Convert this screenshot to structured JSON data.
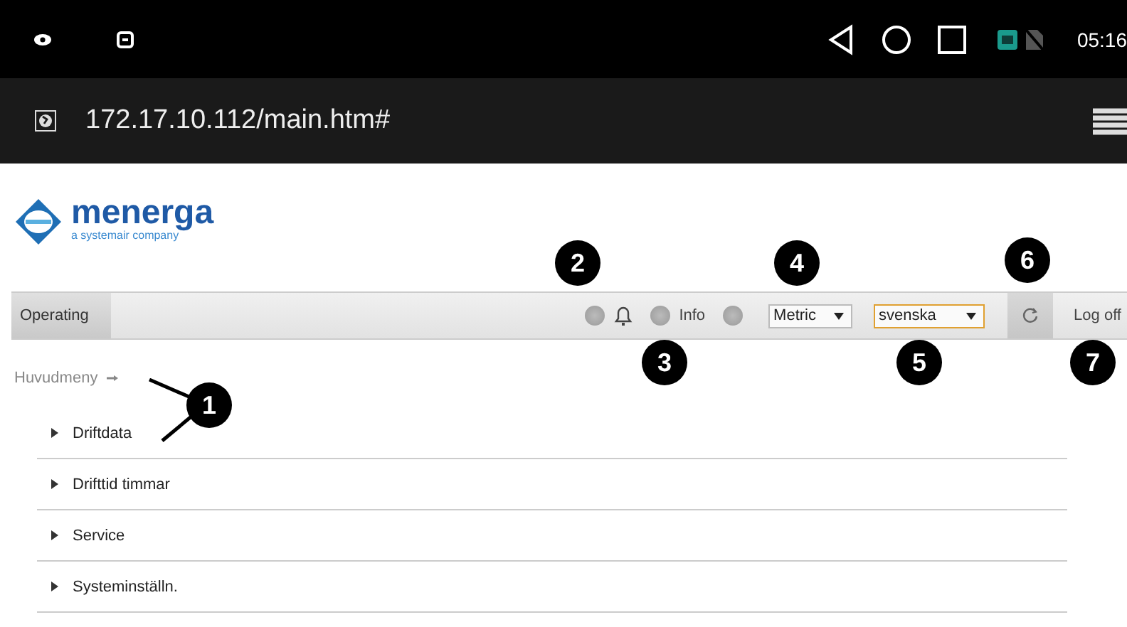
{
  "status_bar": {
    "time": "05:16"
  },
  "address_bar": {
    "url": "172.17.10.112/main.htm#"
  },
  "logo": {
    "name": "menerga",
    "tagline": "a systemair company"
  },
  "toolbar": {
    "status": "Operating",
    "info": "Info",
    "units": {
      "value": "Metric",
      "focused": false
    },
    "language": {
      "value": "svenska",
      "focused": true
    },
    "log_off": "Log off"
  },
  "breadcrumb": "Huvudmeny",
  "menu": [
    {
      "label": "Driftdata",
      "expanded": false
    },
    {
      "label": "Drifttid timmar",
      "expanded": false
    },
    {
      "label": "Service",
      "expanded": false
    },
    {
      "label": "Systeminställn.",
      "expanded": false
    }
  ],
  "callouts": [
    "1",
    "2",
    "3",
    "4",
    "5",
    "6",
    "7"
  ]
}
